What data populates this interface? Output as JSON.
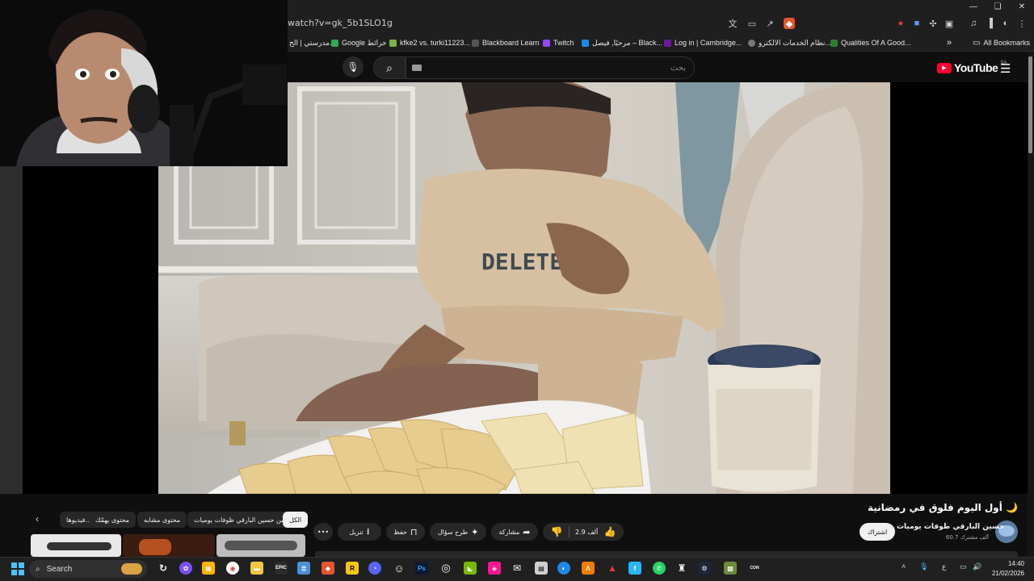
{
  "browser": {
    "url": "watch?v=gk_5b1SLO1g",
    "bookmarks": [
      {
        "label": "مدرستي | الح...",
        "color": "#3f7ad8"
      },
      {
        "label": "Google خرائط",
        "color": "#34a853"
      },
      {
        "label": "kfke2 vs. turki11223...",
        "color": "#7cb342"
      },
      {
        "label": "Blackboard Learn",
        "color": "#444"
      },
      {
        "label": "Twitch",
        "color": "#9146ff"
      },
      {
        "label": "مرحبًا, فيصل – Black...",
        "color": "#1e88e5"
      },
      {
        "label": "Log in | Cambridge...",
        "color": "#6a1b9a"
      },
      {
        "label": "نظام الخدمات الالكترو...",
        "color": "#777"
      },
      {
        "label": "Qualities Of A Good...",
        "color": "#2e7d32"
      }
    ],
    "all_bookmarks": "All Bookmarks",
    "overflow": "»"
  },
  "youtube": {
    "logo_text": "YouTube",
    "region": "SA",
    "search_placeholder": "بحث"
  },
  "video": {
    "title": "أول اليوم فلوق في رمضانية 🌙",
    "channel_name": "حسين البارقي ظوفات يوميات",
    "subscribers": "60.7 ألف مشترك",
    "subscribe_label": "اشتراك",
    "like_count": "2.9 ألف",
    "share_label": "مشاركة",
    "ask_label": "طرح سؤال",
    "save_label": "حفظ",
    "download_label": "تنزيل",
    "shirt_text": "DELETE"
  },
  "chips": [
    {
      "label": "الكل",
      "active": true
    },
    {
      "label": "من حسين البارقي ظوفات يوميات",
      "active": false
    },
    {
      "label": "محتوى مشابه",
      "active": false
    },
    {
      "label": "محتوى يهمّك",
      "active": false
    },
    {
      "label": "فيديوها...",
      "active": false
    }
  ],
  "taskbar": {
    "search_label": "Search",
    "time": "14:40",
    "date": "21/02/2026",
    "lang": "ع"
  },
  "colors": {
    "youtube_red": "#ff0033",
    "page_bg": "#0f0f0f",
    "pill_bg": "#272727"
  }
}
